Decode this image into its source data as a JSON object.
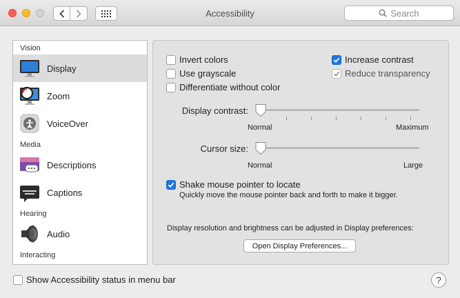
{
  "window": {
    "title": "Accessibility"
  },
  "toolbar": {
    "search_placeholder": "Search"
  },
  "sidebar": {
    "sections": [
      {
        "label": "Vision"
      },
      {
        "label": "Media"
      },
      {
        "label": "Hearing"
      },
      {
        "label": "Interacting"
      }
    ],
    "items": [
      {
        "label": "Display",
        "icon": "display-icon",
        "selected": true
      },
      {
        "label": "Zoom",
        "icon": "zoom-icon"
      },
      {
        "label": "VoiceOver",
        "icon": "voiceover-icon"
      },
      {
        "label": "Descriptions",
        "icon": "descriptions-icon"
      },
      {
        "label": "Captions",
        "icon": "captions-icon"
      },
      {
        "label": "Audio",
        "icon": "speaker-icon"
      }
    ]
  },
  "display": {
    "invert_colors": {
      "label": "Invert colors",
      "checked": false
    },
    "use_grayscale": {
      "label": "Use grayscale",
      "checked": false
    },
    "differentiate": {
      "label": "Differentiate without color",
      "checked": false
    },
    "increase_contrast": {
      "label": "Increase contrast",
      "checked": true
    },
    "reduce_transparency": {
      "label": "Reduce transparency",
      "checked": true,
      "disabled": true
    },
    "contrast_slider": {
      "label": "Display contrast:",
      "min_label": "Normal",
      "max_label": "Maximum",
      "value": 0
    },
    "cursor_slider": {
      "label": "Cursor size:",
      "min_label": "Normal",
      "max_label": "Large",
      "value": 0
    },
    "shake": {
      "label": "Shake mouse pointer to locate",
      "checked": true,
      "help": "Quickly move the mouse pointer back and forth to make it bigger."
    },
    "resolution_note": "Display resolution and brightness can be adjusted in Display preferences:",
    "open_prefs_button": "Open Display Preferences..."
  },
  "footer": {
    "status_menu": {
      "label": "Show Accessibility status in menu bar",
      "checked": false
    },
    "help_label": "?"
  }
}
